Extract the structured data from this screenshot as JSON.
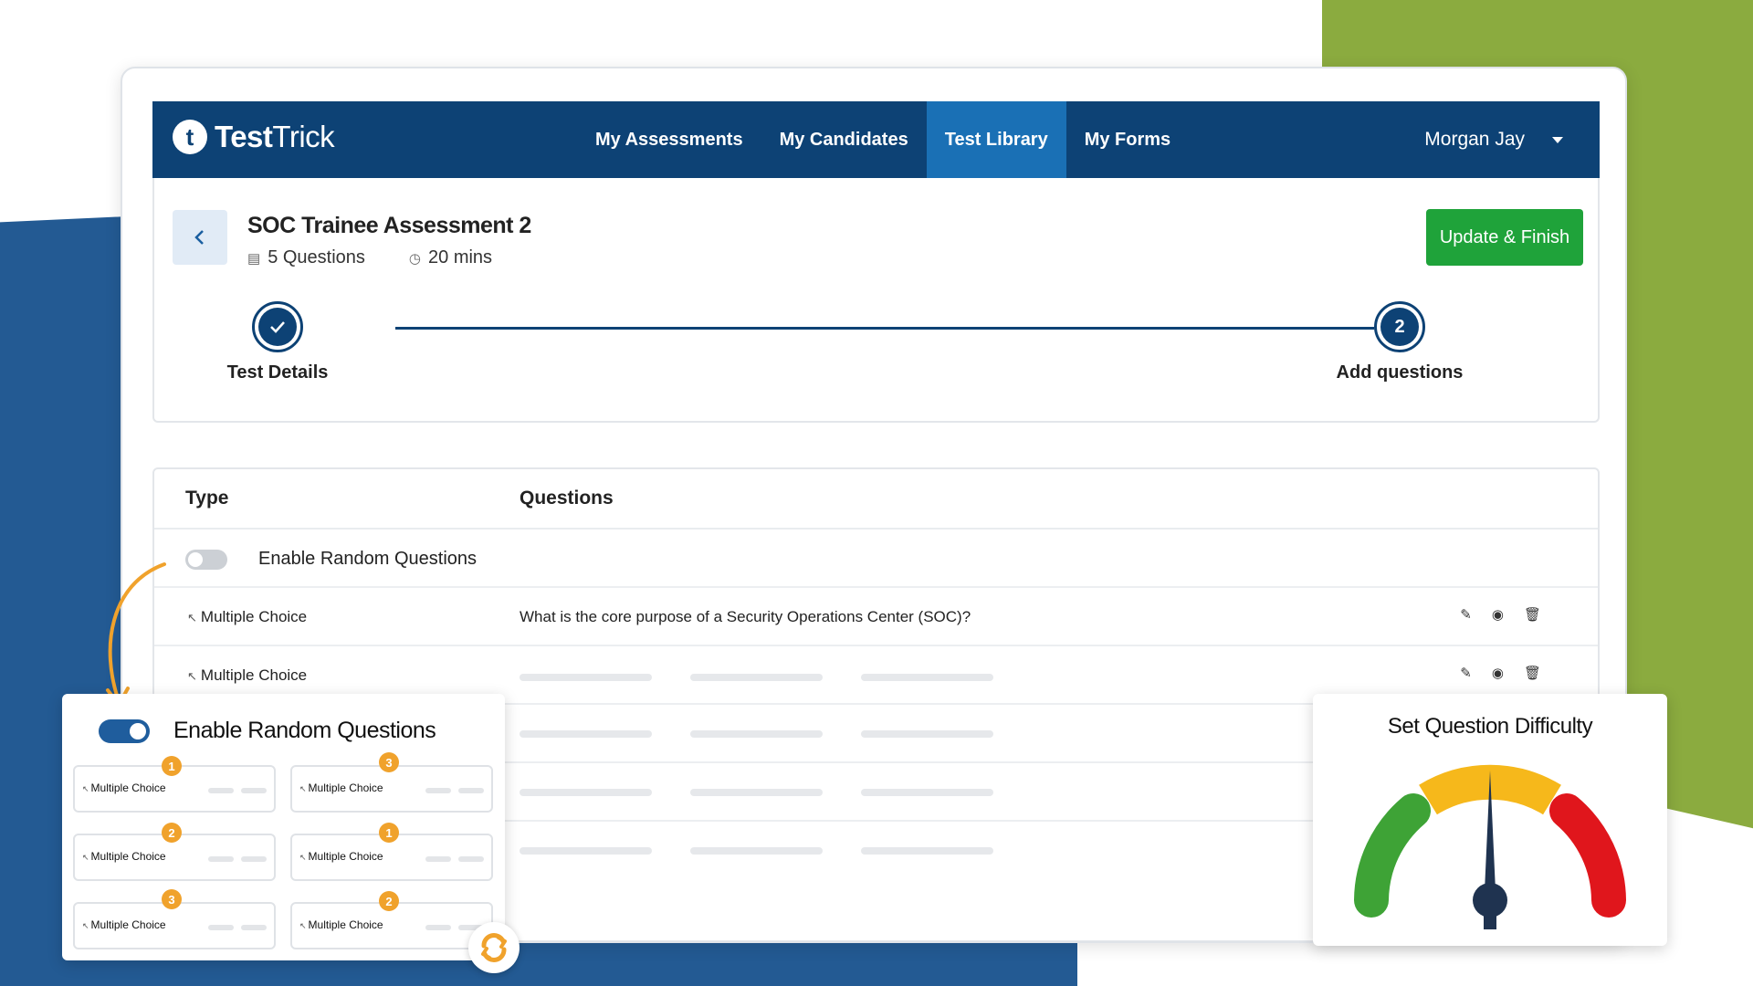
{
  "brand": {
    "logo_mark": "t",
    "name_bold": "Test",
    "name_light": "Trick"
  },
  "nav": {
    "items": [
      "My Assessments",
      "My Candidates",
      "Test Library",
      "My Forms"
    ],
    "active": "Test Library",
    "user": "Morgan Jay"
  },
  "test": {
    "title": "SOC Trainee Assessment 2",
    "questions": "5 Questions",
    "duration": "20 mins",
    "update_label": "Update & Finish"
  },
  "steps": [
    {
      "label": "Test Details",
      "status": "done"
    },
    {
      "label": "Add questions",
      "number": "2",
      "status": "current"
    }
  ],
  "table": {
    "headers": {
      "type": "Type",
      "questions": "Questions"
    },
    "random_label": "Enable Random Questions",
    "rows": [
      {
        "type": "Multiple Choice",
        "question": "What is the core purpose of a Security Operations Center (SOC)?"
      },
      {
        "type": "Multiple Choice",
        "question": ""
      }
    ]
  },
  "random_panel": {
    "title": "Enable Random Questions",
    "enabled": true,
    "cards": [
      {
        "label": "Multiple Choice",
        "badge": "1"
      },
      {
        "label": "Multiple Choice",
        "badge": "3"
      },
      {
        "label": "Multiple Choice",
        "badge": "2"
      },
      {
        "label": "Multiple Choice",
        "badge": "1"
      },
      {
        "label": "Multiple Choice",
        "badge": "3"
      },
      {
        "label": "Multiple Choice",
        "badge": "2"
      }
    ]
  },
  "difficulty": {
    "title": "Set Question Difficulty",
    "colors": {
      "easy": "#3ea336",
      "medium": "#f6b81b",
      "hard": "#e0161c",
      "needle": "#1f3350"
    }
  },
  "colors": {
    "nav": "#0d4275",
    "nav_active": "#1a70b5",
    "primary_button": "#1fa33a",
    "accent_orange": "#f0a22c"
  }
}
